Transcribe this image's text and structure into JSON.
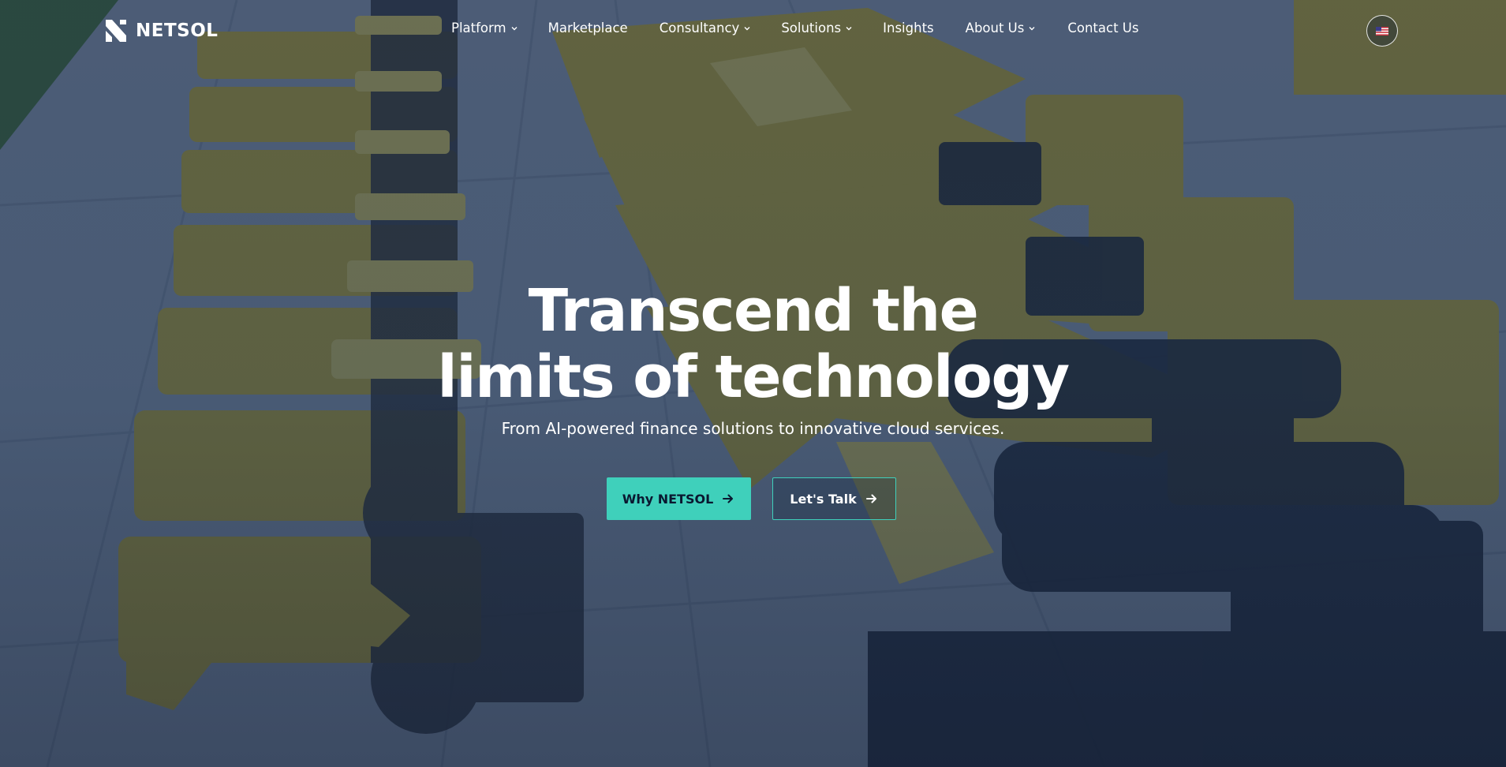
{
  "brand": {
    "name": "NETSOL"
  },
  "nav": {
    "items": [
      {
        "label": "Platform",
        "has_dropdown": true
      },
      {
        "label": "Marketplace",
        "has_dropdown": false
      },
      {
        "label": "Consultancy",
        "has_dropdown": true
      },
      {
        "label": "Solutions",
        "has_dropdown": true
      },
      {
        "label": "Insights",
        "has_dropdown": false
      },
      {
        "label": "About Us",
        "has_dropdown": true
      },
      {
        "label": "Contact Us",
        "has_dropdown": false
      }
    ],
    "language_icon": "us-flag-icon"
  },
  "hero": {
    "headline_line1": "Transcend the",
    "headline_line2": "limits of technology",
    "subheadline": "From AI-powered finance solutions to innovative cloud services.",
    "primary_cta": "Why NETSOL",
    "secondary_cta": "Let's Talk",
    "background_description_icon": "construction-equipment-photo"
  },
  "colors": {
    "accent": "#3fd0bb",
    "overlay": "#0c2044",
    "text": "#ffffff"
  }
}
